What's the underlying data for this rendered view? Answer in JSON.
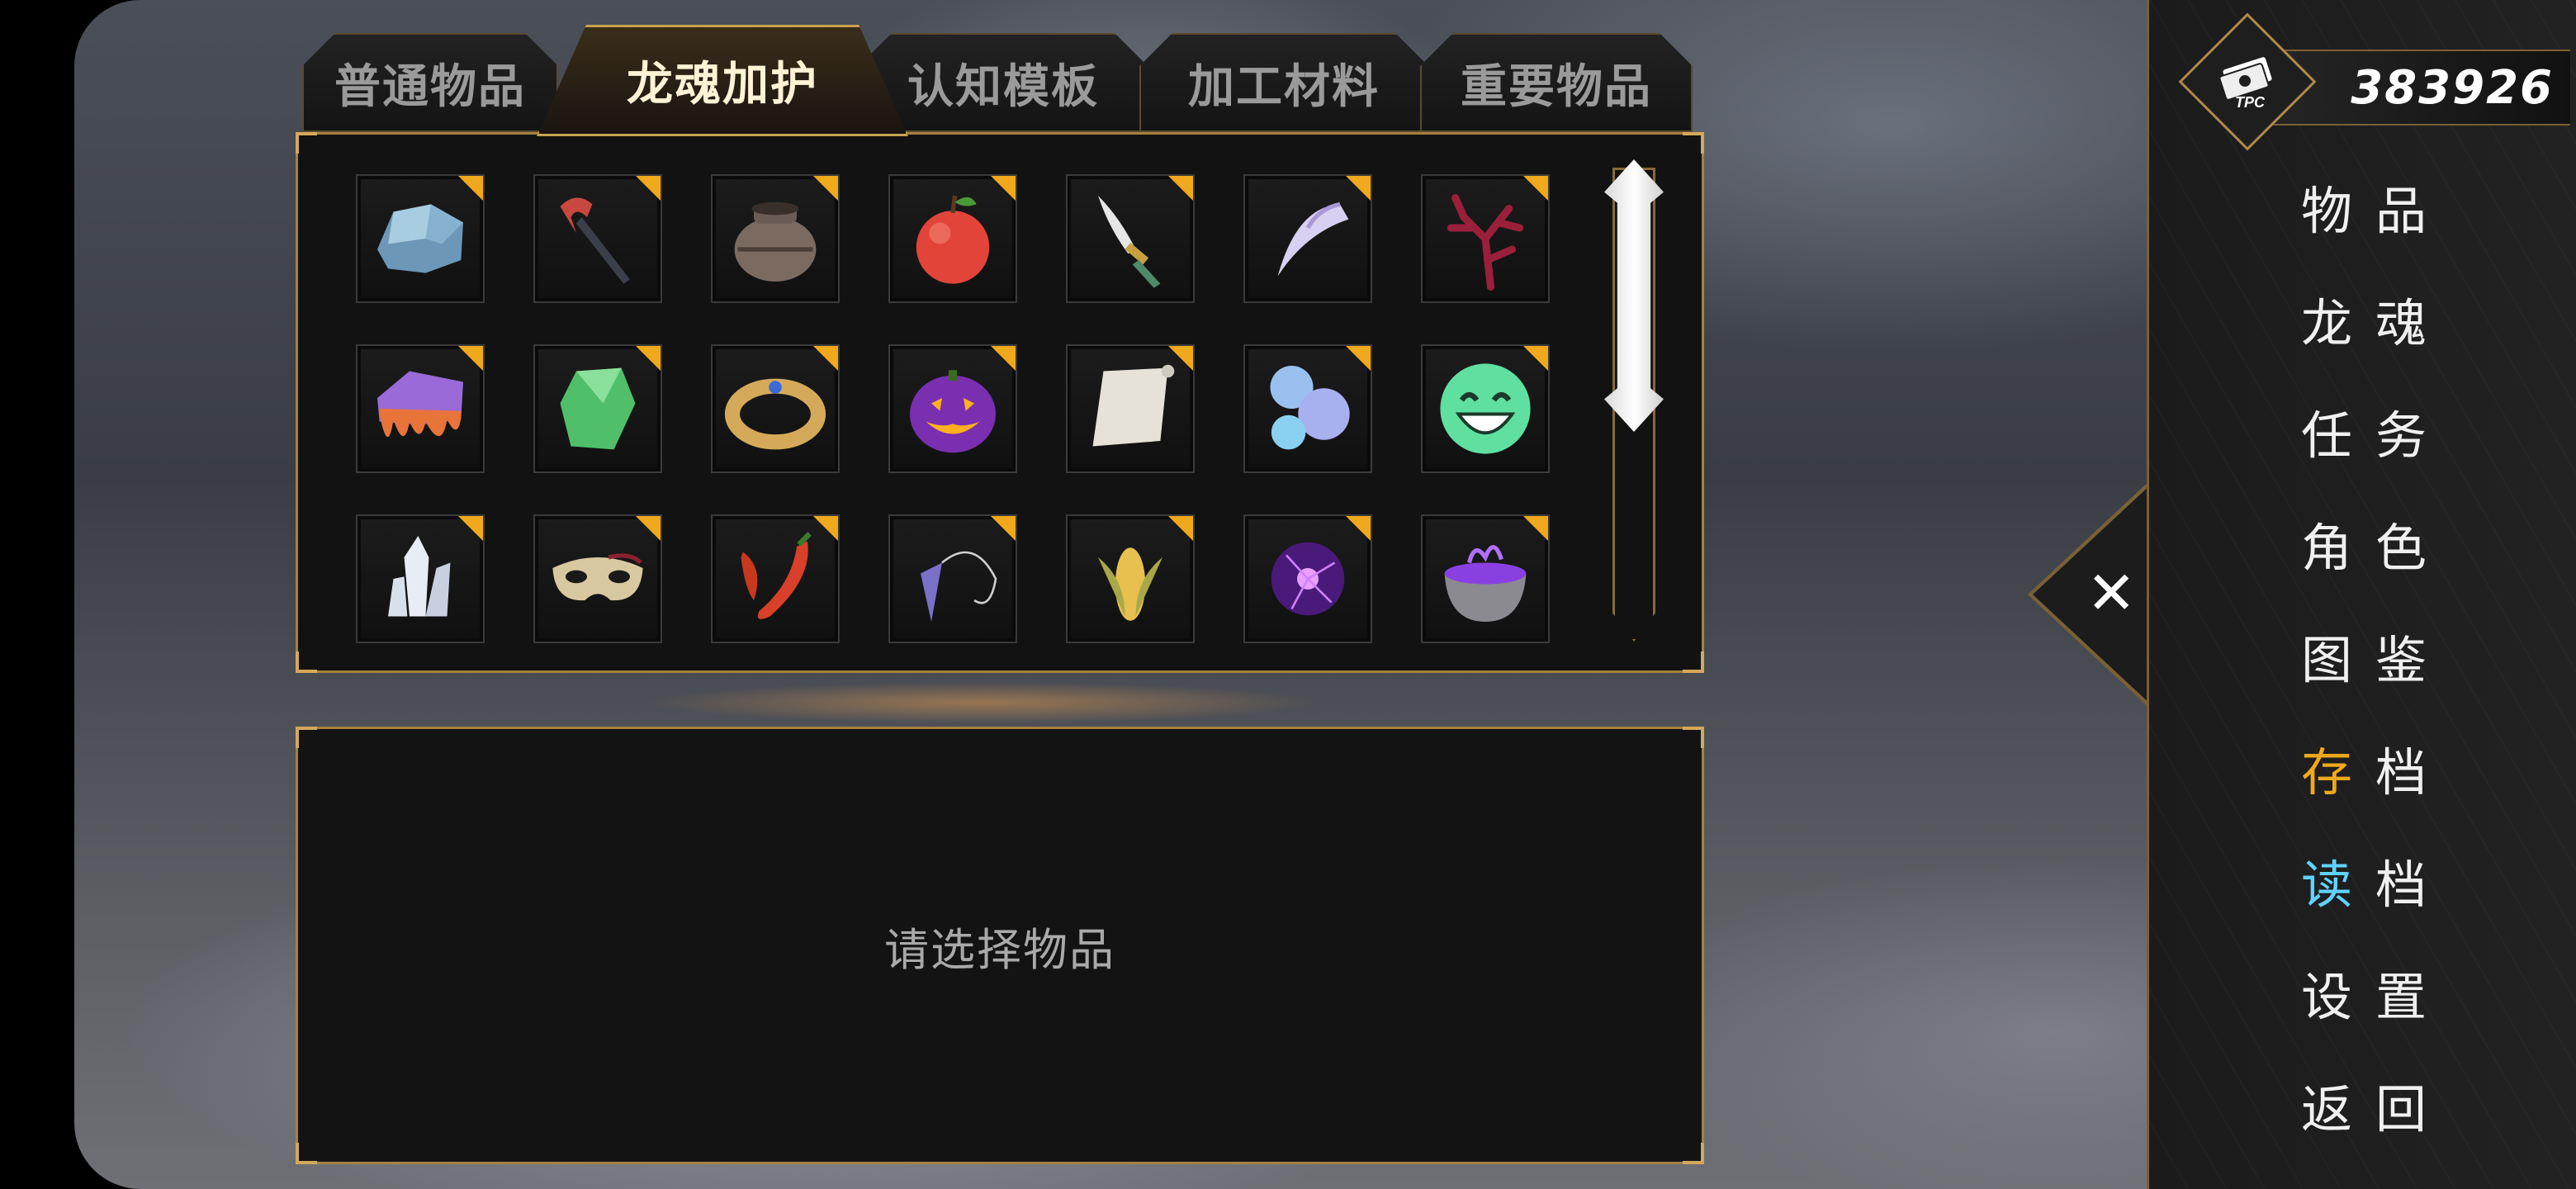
{
  "tabs": [
    {
      "label": "普通物品",
      "active": false
    },
    {
      "label": "龙魂加护",
      "active": true
    },
    {
      "label": "认知模板",
      "active": false
    },
    {
      "label": "加工材料",
      "active": false
    },
    {
      "label": "重要物品",
      "active": false
    }
  ],
  "items": [
    "crystal-ore-icon",
    "red-hook-icon",
    "clay-pot-icon",
    "apple-icon",
    "dagger-icon",
    "fang-icon",
    "coral-icon",
    "slime-ore-icon",
    "green-gem-icon",
    "gold-bracelet-icon",
    "jack-o-lantern-icon",
    "scroll-icon",
    "bubble-icon",
    "grinning-face-icon",
    "quartz-crystal-icon",
    "masquerade-mask-icon",
    "chili-pepper-icon",
    "pendulum-icon",
    "corn-icon",
    "plasma-ball-icon",
    "cauldron-icon"
  ],
  "description": {
    "placeholder": "请选择物品"
  },
  "currency": {
    "icon": "tpc-cash-icon",
    "label": "TPC",
    "value": "383926"
  },
  "menu": [
    {
      "label": "物品",
      "accent": ""
    },
    {
      "label": "龙魂",
      "accent": ""
    },
    {
      "label": "任务",
      "accent": ""
    },
    {
      "label": "角色",
      "accent": ""
    },
    {
      "label": "图鉴",
      "accent": ""
    },
    {
      "first": "存",
      "rest": "档",
      "accent": "#f0a81c"
    },
    {
      "first": "读",
      "rest": "档",
      "accent": "#5fd3ff"
    },
    {
      "label": "设置",
      "accent": ""
    },
    {
      "label": "返回",
      "accent": ""
    }
  ],
  "colors": {
    "gold_border": "#a8813e",
    "slot_flag": "#f0a81c",
    "save_accent": "#f0a81c",
    "load_accent": "#5fd3ff"
  }
}
